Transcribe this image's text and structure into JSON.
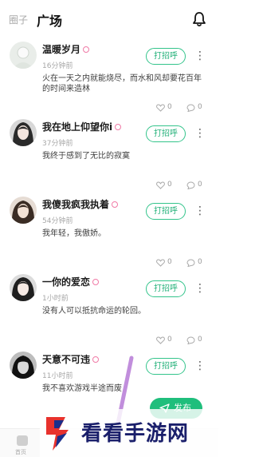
{
  "header": {
    "tab_circle": "圈子",
    "tab_square": "广场",
    "bell_icon": "bell-icon"
  },
  "posts": [
    {
      "name": "温暖岁月",
      "time": "16分钟前",
      "text": "火在一天之内就能烧尽，而水和风却要花百年的时间来造林",
      "greet": "打招呼",
      "likes": "0",
      "comments": "0"
    },
    {
      "name": "我在地上仰望你i",
      "time": "37分钟前",
      "text": "我终于感到了无比的寂寞",
      "greet": "打招呼",
      "likes": "0",
      "comments": "0"
    },
    {
      "name": "我傻我疯我执着",
      "time": "54分钟前",
      "text": "我年轻，我傲娇。",
      "greet": "打招呼",
      "likes": "0",
      "comments": "0"
    },
    {
      "name": "一你的爱恋",
      "time": "1小时前",
      "text": "没有人可以抵抗命运的轮回。",
      "greet": "打招呼",
      "likes": "0",
      "comments": "0"
    },
    {
      "name": "天意不可违",
      "time": "11小时前",
      "text": "我不喜欢游戏半途而废",
      "greet": "打招呼",
      "likes": "",
      "comments": ""
    }
  ],
  "publish_label": "发布",
  "bottom_nav": {
    "home_label": "首页"
  },
  "watermark": {
    "text": "看看手游网"
  },
  "colors": {
    "accent": "#1fbe7c",
    "name_mark": "#f07aa6",
    "watermark": "#1a1f6b"
  }
}
